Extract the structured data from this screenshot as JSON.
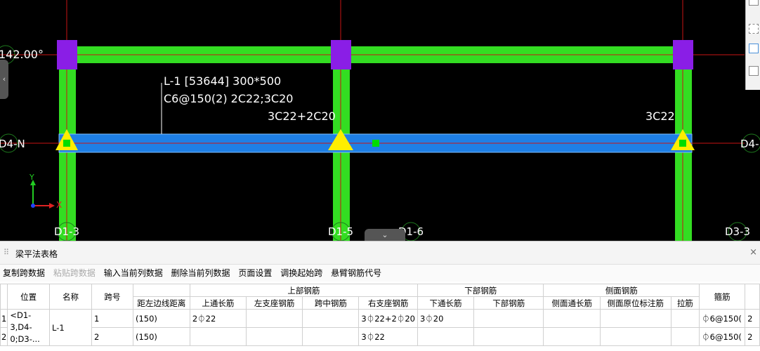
{
  "canvas": {
    "angle_label": "142.00°",
    "axis_labels": {
      "left_mid": "D4-N",
      "right_mid": "D4-",
      "bottom_1": "D1-3",
      "bottom_2": "D1-5",
      "bottom_3": "D1-6",
      "bottom_4": "D3-3"
    },
    "beam_label_line1": "L-1 [53644] 300*500",
    "beam_label_line2": "C6@150(2) 2C22;3C20",
    "support_label_mid": "3C22+2C20",
    "support_label_right": "3C22",
    "ucs": {
      "x": "X",
      "y": "Y"
    },
    "colors": {
      "background": "#000000",
      "beam_green": "#33dd22",
      "beam_blue": "#1e7fe6",
      "column_purple": "#8a1ee6",
      "axis_red": "#c81414",
      "support_yellow": "#ffee00",
      "marker_green": "#00dd00"
    }
  },
  "panel": {
    "title": "梁平法表格",
    "close": "×",
    "toolbar": [
      "复制跨数据",
      "粘贴跨数据",
      "输入当前列数据",
      "删除当前列数据",
      "页面设置",
      "调换起始跨",
      "悬臂钢筋代号"
    ],
    "toolbar_disabled": [
      1
    ],
    "headers": {
      "position": "位置",
      "name": "名称",
      "span": "跨号",
      "top_rebar": "上部钢筋",
      "bottom_rebar": "下部钢筋",
      "side_rebar": "侧面钢筋",
      "stirrup": "箍筋",
      "dist_left": "距左边线距离",
      "top_through": "上通长筋",
      "left_support": "左支座钢筋",
      "mid_span": "跨中钢筋",
      "right_support": "右支座钢筋",
      "bottom_through": "下通长筋",
      "bottom_bar": "下部钢筋",
      "side_through": "侧面通长筋",
      "side_original": "侧面原位标注筋",
      "tie": "拉筋"
    },
    "rows": [
      {
        "num": "1",
        "position": "<D1-3,D4-0;D3-...",
        "name": "L-1",
        "span": "1",
        "dist": "(150)",
        "top_through": "2⏀22",
        "left_support": "",
        "mid_span": "",
        "right_support": "3⏀22+2⏀20",
        "bottom_through": "3⏀20",
        "bottom_bar": "",
        "side_through": "",
        "side_original": "",
        "tie": "",
        "stirrup": "⏀6@150(",
        "extra": "2"
      },
      {
        "num": "2",
        "position": "",
        "name": "",
        "span": "2",
        "dist": "(150)",
        "top_through": "",
        "left_support": "",
        "mid_span": "",
        "right_support": "3⏀22",
        "bottom_through": "",
        "bottom_bar": "",
        "side_through": "",
        "side_original": "",
        "tie": "",
        "stirrup": "⏀6@150(",
        "extra": "2"
      }
    ]
  }
}
